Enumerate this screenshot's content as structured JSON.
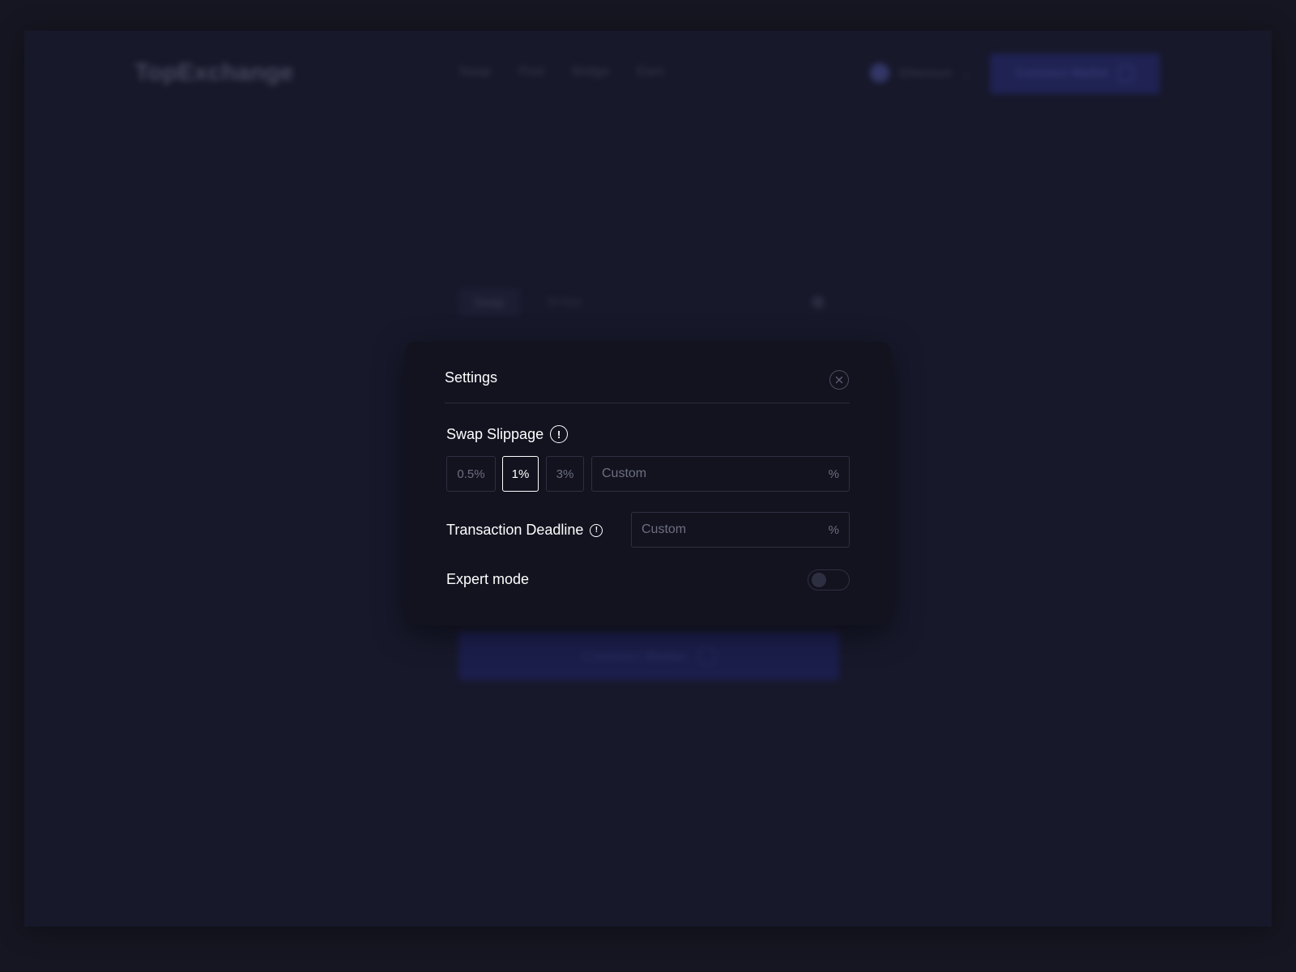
{
  "background": {
    "logo": "TopExchange",
    "nav": [
      "Swap",
      "Pool",
      "Bridge",
      "Earn"
    ],
    "network": "Ethereum",
    "connect_label": "Connect Wallet",
    "tabs": [
      "Swap",
      "Bridge"
    ],
    "cta_label": "Connect Wallet"
  },
  "settings": {
    "title": "Settings",
    "slippage": {
      "label": "Swap Slippage",
      "options": [
        "0.5%",
        "1%",
        "3%"
      ],
      "selected": "1%",
      "custom_placeholder": "Custom",
      "unit": "%"
    },
    "deadline": {
      "label": "Transaction Deadline",
      "custom_placeholder": "Custom",
      "unit": "%"
    },
    "expert_mode": {
      "label": "Expert mode",
      "enabled": false
    }
  },
  "colors": {
    "page_bg": "#151621",
    "modal_bg": "#12131f",
    "accent_blue": "#262b74",
    "muted_text": "#6d6f82"
  }
}
